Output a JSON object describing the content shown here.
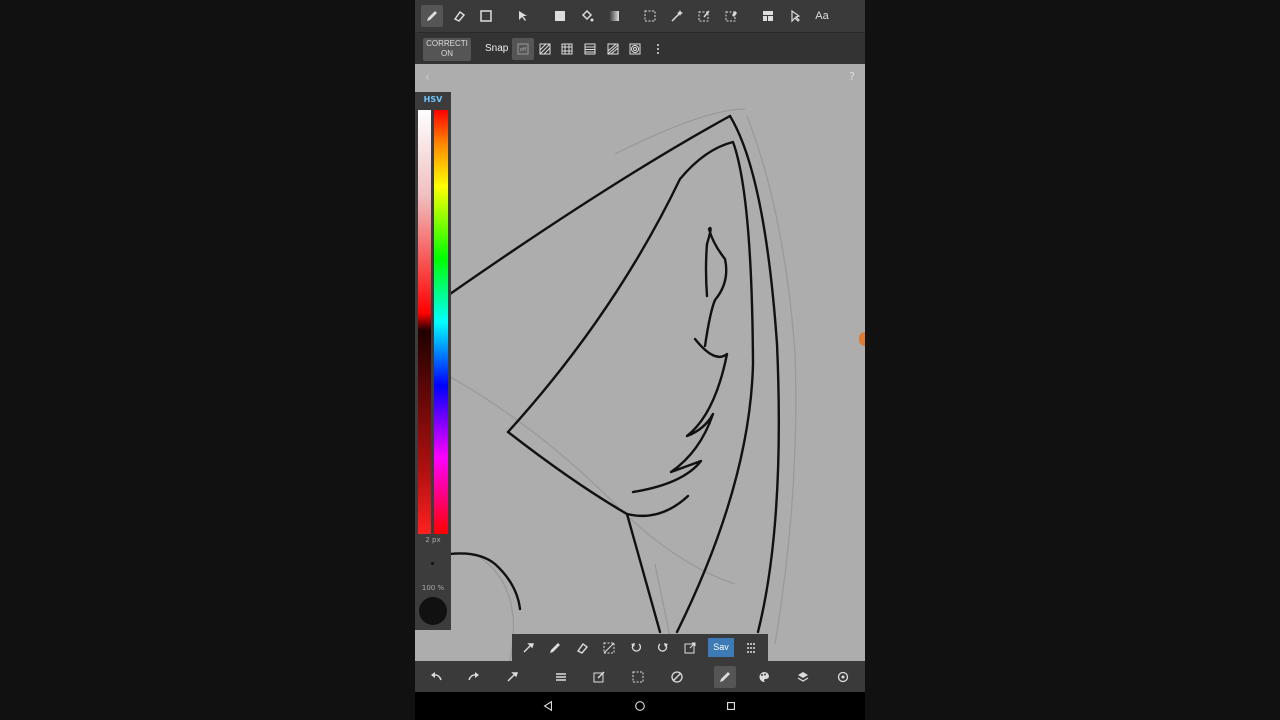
{
  "top_toolbar": {
    "tools": [
      "pen-icon",
      "eraser-icon",
      "square-icon",
      "move-icon",
      "fill-rect-icon",
      "bucket-icon",
      "gradient-icon",
      "select-rect-icon",
      "magic-wand-icon",
      "select-pen-icon",
      "select-eraser-icon",
      "layout-icon",
      "pointer-icon",
      "text-icon"
    ],
    "text_tool_label": "Aa"
  },
  "second_toolbar": {
    "correction_label": "CORRECTI ON",
    "snap_label": "Snap",
    "snap_options": [
      "snap-off-icon",
      "snap-parallel-icon",
      "snap-grid-icon",
      "snap-horizontal-icon",
      "snap-perspective-icon",
      "snap-concentric-icon",
      "more-icon"
    ]
  },
  "canvas": {
    "help_label": "?"
  },
  "color_panel": {
    "mode_label": "HSV",
    "brush_size": "2 px",
    "opacity": "100 %",
    "current_color": "#111111"
  },
  "floating_bar": {
    "tools": [
      "eyedropper-icon",
      "pen-icon",
      "eraser-icon",
      "deselect-icon",
      "undo-rotate-icon",
      "redo-rotate-icon",
      "transform-icon"
    ],
    "save_label": "Sav"
  },
  "bottom_toolbar": {
    "tools": [
      "undo-icon",
      "redo-icon",
      "eyedropper-icon",
      "menu-icon",
      "edit-icon",
      "selection-icon",
      "no-snap-icon",
      "pen-icon",
      "palette-icon",
      "layers-icon",
      "settings-icon"
    ]
  },
  "colors": {
    "accent": "#3e7bb6",
    "hsv_label": "#6cc3ff"
  }
}
